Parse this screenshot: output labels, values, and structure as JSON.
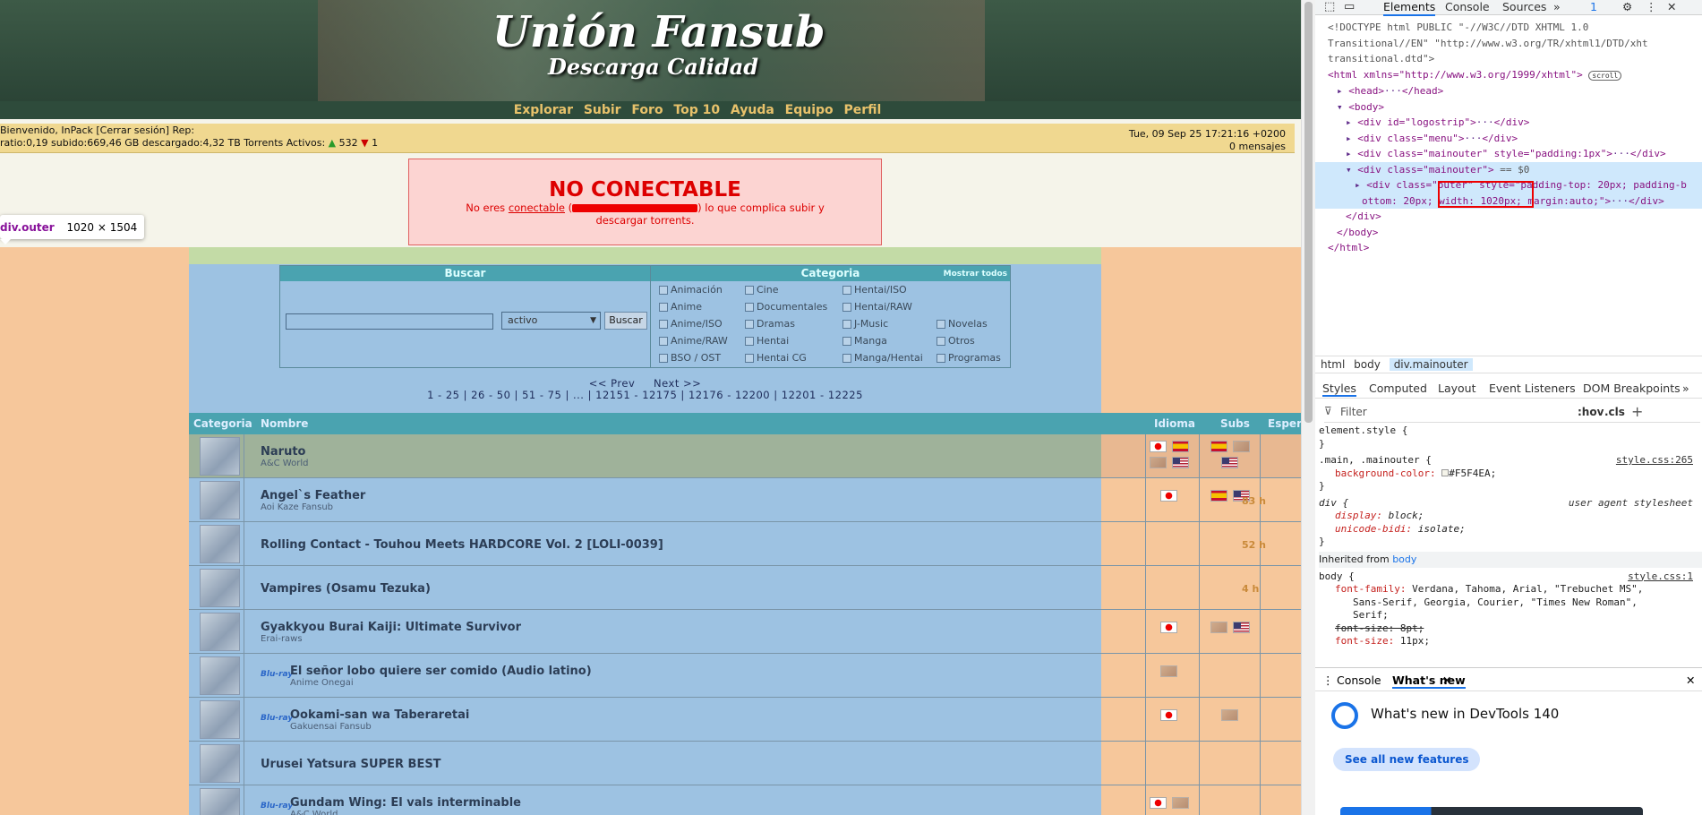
{
  "site": {
    "title": "Unión Fansub",
    "subtitle": "Descarga Calidad",
    "menu": [
      "Explorar",
      "Subir",
      "Foro",
      "Top 10",
      "Ayuda",
      "Equipo",
      "Perfil"
    ]
  },
  "userbar": {
    "welcome": "Bienvenido, InPack  [Cerrar sesión] Rep:",
    "stats": "ratio:0,19  subido:669,46 GB  descargado:4,32 TB  Torrents Activos:",
    "up_arrow": "▲",
    "seeding": "532",
    "down_arrow": "▼",
    "leeching": "1",
    "datetime": "Tue, 09 Sep 25 17:21:16 +0200",
    "messages": "0 mensajes"
  },
  "notice": {
    "title": "NO CONECTABLE",
    "text_before": "No eres ",
    "link": "conectable",
    "text_after": ") lo que complica subir y descargar torrents.",
    "paren_open": " ("
  },
  "tooltip": {
    "selector": "div.outer",
    "size": "1020 × 1504"
  },
  "search": {
    "header": "Buscar",
    "category_header": "Categoria",
    "show_all": "Mostrar todos",
    "input_value": "",
    "select_value": "activo",
    "button": "Buscar",
    "categories": [
      [
        "Animación",
        "Cine",
        "Hentai/ISO"
      ],
      [
        "Anime",
        "Documentales",
        "Hentai/RAW"
      ],
      [
        "Anime/ISO",
        "Dramas",
        "J-Music",
        "Novelas"
      ],
      [
        "Anime/RAW",
        "Hentai",
        "Manga",
        "Otros"
      ],
      [
        "BSO / OST",
        "Hentai CG",
        "Manga/Hentai",
        "Programas"
      ]
    ]
  },
  "pagination": {
    "prev": "<< Prev",
    "next": "Next >>",
    "pages": "1 - 25 | 26 - 50 | 51 - 75 | ... | 12151 - 12175 | 12176 - 12200 | 12201 - 12225"
  },
  "table": {
    "headers": [
      "Categoria",
      "Nombre",
      "Idioma",
      "Subs",
      "Esper"
    ],
    "rows": [
      {
        "name": "Naruto",
        "group": "A&C World",
        "age": ""
      },
      {
        "name": "Angel`s Feather",
        "group": "Aoi Kaze Fansub",
        "age": "83 h"
      },
      {
        "name": "Rolling Contact - Touhou Meets HARDCORE Vol. 2 [LOLI-0039]",
        "group": "",
        "age": "52 h"
      },
      {
        "name": "Vampires (Osamu Tezuka)",
        "group": "",
        "age": "4 h"
      },
      {
        "name": "Gyakkyou Burai Kaiji: Ultimate Survivor",
        "group": "Erai-raws",
        "age": ""
      },
      {
        "name": "El señor lobo quiere ser comido (Audio latino)",
        "group": "Anime Onegai",
        "age": ""
      },
      {
        "name": "Ookami-san wa Taberaretai",
        "group": "Gakuensai Fansub",
        "age": ""
      },
      {
        "name": "Urusei Yatsura SUPER BEST",
        "group": "",
        "age": ""
      },
      {
        "name": "Gundam Wing: El vals interminable",
        "group": "A&C World",
        "age": ""
      }
    ]
  },
  "devtools": {
    "tabs": [
      "Elements",
      "Console",
      "Sources"
    ],
    "badge": "1",
    "doctype1": "<!DOCTYPE html PUBLIC \"-//W3C//DTD XHTML 1.0",
    "doctype2": "Transitional//EN\" \"http://www.w3.org/TR/xhtml1/DTD/xht",
    "doctype3": "transitional.dtd\">",
    "html_open": "<html xmlns=\"http://www.w3.org/1999/xhtml\">",
    "scroll_badge": "scroll",
    "head": "<head>",
    "head_close": "</head>",
    "body": "<body>",
    "div_logo": "<div id=\"logostrip\">",
    "div_menu": "<div class=\"menu\">",
    "div_main1": "<div class=\"mainouter\" style=\"padding:1px\">",
    "div_main2": "<div class=\"mainouter\">",
    "eq": "== $0",
    "div_outer1": "<div class=\"outer\" style=\"padding-top: 20px; padding-b",
    "div_outer2": "ottom: 20px; width: 1020px; margin:auto;\">",
    "div_close": "</div>",
    "dots": "···",
    "close_div": "</div>",
    "close_body": "</body>",
    "close_html": "</html>",
    "breadcrumbs": [
      "html",
      "body",
      "div.mainouter"
    ],
    "style_tabs": [
      "Styles",
      "Computed",
      "Layout",
      "Event Listeners",
      "DOM Breakpoints"
    ],
    "filter": "Filter",
    "hov": ":hov",
    "cls": ".cls",
    "styles": {
      "element_style": "element.style {",
      "brace_close": "}",
      "rule1_sel": ".main, .mainouter {",
      "rule1_src": "style.css:265",
      "rule1_prop": "background-color:",
      "rule1_val": "#F5F4EA;",
      "rule2_sel": "div {",
      "rule2_src": "user agent stylesheet",
      "rule2_p1": "display:",
      "rule2_v1": "block;",
      "rule2_p2": "unicode-bidi:",
      "rule2_v2": "isolate;",
      "inherited": "Inherited from",
      "inherited_from": "body",
      "rule3_sel": "body {",
      "rule3_src": "style.css:1",
      "rule3_p1": "font-family:",
      "rule3_v1a": "Verdana, Tahoma, Arial, \"Trebuchet MS\",",
      "rule3_v1b": "Sans-Serif, Georgia, Courier, \"Times New Roman\",",
      "rule3_v1c": "Serif;",
      "rule3_p2": "font-size: 8pt;",
      "rule3_p3": "font-size:",
      "rule3_v3": "11px;"
    },
    "drawer_tabs": [
      "Console",
      "What's new"
    ],
    "whats_new_title": "What's new in DevTools 140",
    "see_all": "See all new features"
  }
}
